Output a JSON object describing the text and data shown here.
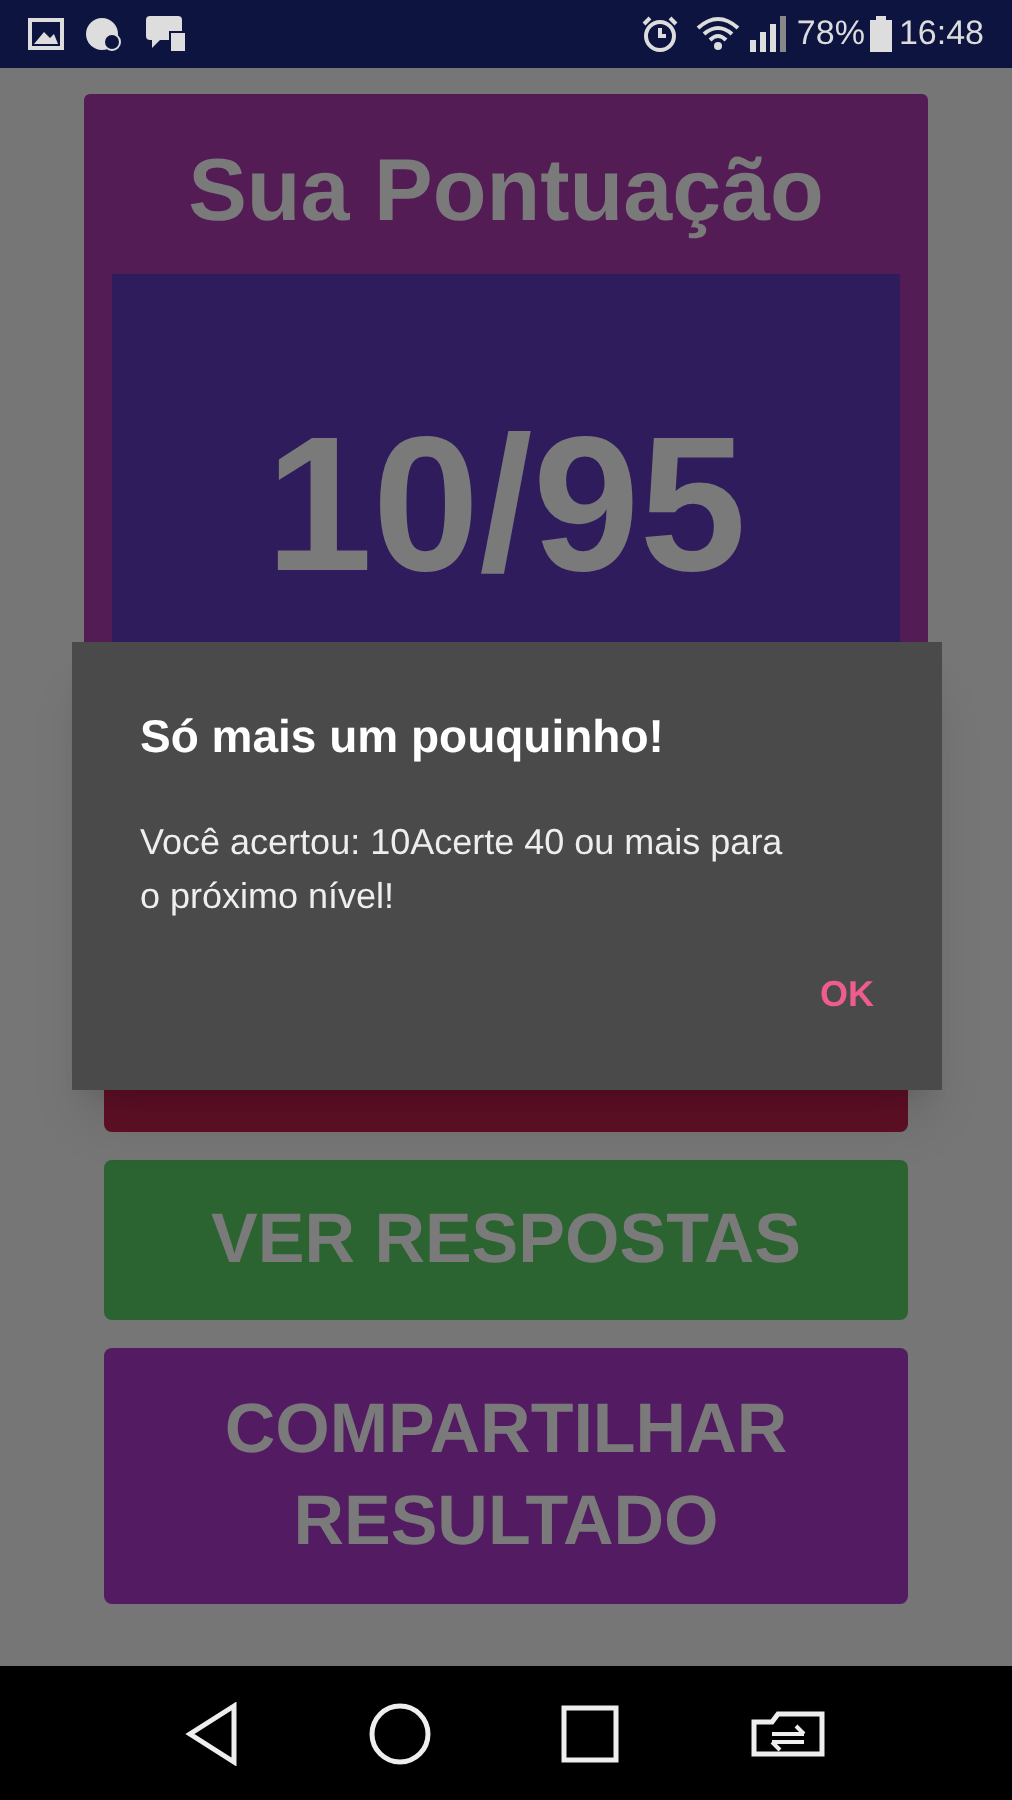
{
  "status_bar": {
    "battery": "78%",
    "time": "16:48"
  },
  "score_card": {
    "title": "Sua Pontuação",
    "score": "10/95"
  },
  "buttons": [
    {
      "kind": "next"
    },
    {
      "label": "VER RESPOSTAS",
      "kind": "answers"
    },
    {
      "label": "COMPARTILHAR RESULTADO",
      "kind": "share"
    }
  ],
  "dialog": {
    "title": "Só mais um pouquinho!",
    "message": "Você acertou: 10Acerte 40 ou mais para o próximo nível!",
    "ok": "OK"
  }
}
